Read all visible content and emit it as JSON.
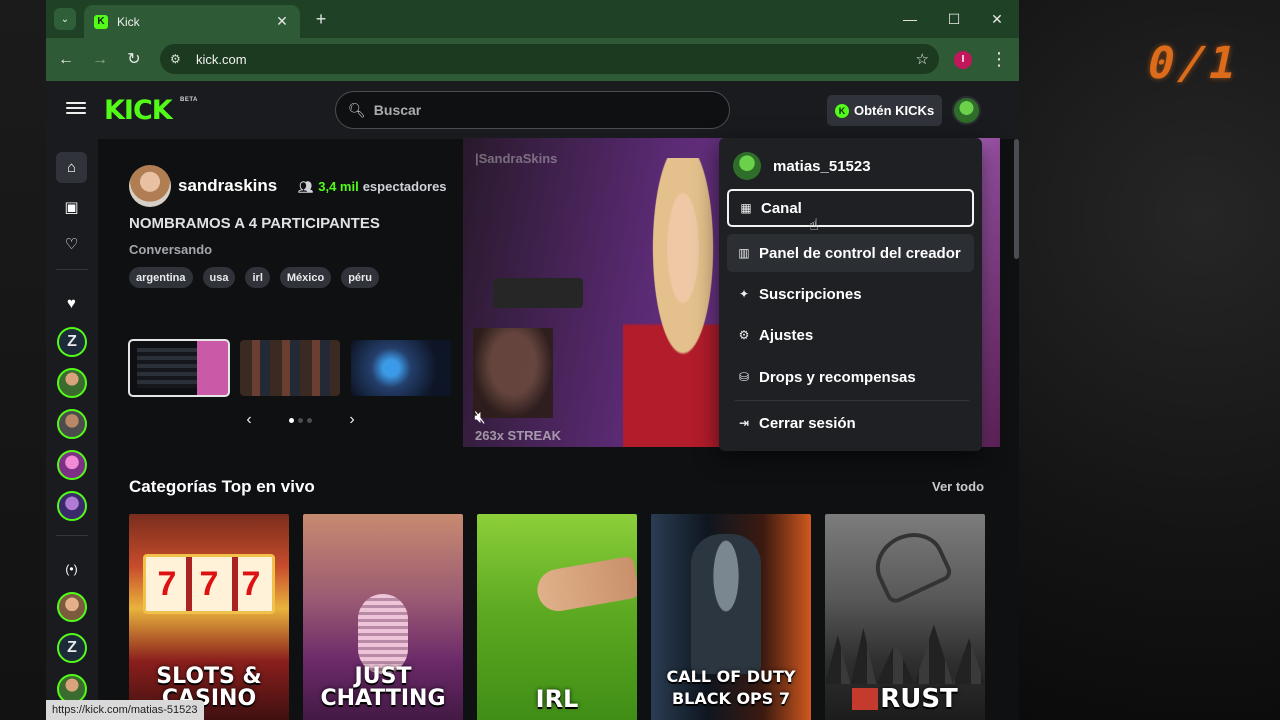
{
  "browser": {
    "tab_title": "Kick",
    "tab_favicon": "K",
    "url": "kick.com",
    "profile_initial": "I",
    "status_url": "https://kick.com/matias-51523"
  },
  "nav": {
    "logo": "KICK",
    "beta": "BETA",
    "search_placeholder": "Buscar",
    "get_kicks": "Obtén KICKs",
    "kicks_coin": "K"
  },
  "featured": {
    "streamer": "sandraskins",
    "viewer_count": "3,4 mil",
    "viewers_label": "espectadores",
    "title": "NOMBRAMOS A 4 PARTICIPANTES",
    "category": "Conversando",
    "tags": [
      "argentina",
      "usa",
      "irl",
      "México",
      "péru"
    ],
    "video_overlay": "|SandraSkins",
    "streak_text": "263x STREAK"
  },
  "dropdown": {
    "username": "matias_51523",
    "items": [
      {
        "label": "Canal",
        "icon": "channel-icon"
      },
      {
        "label": "Panel de control del creador",
        "icon": "dashboard-icon"
      },
      {
        "label": "Suscripciones",
        "icon": "sparkle-icon"
      },
      {
        "label": "Ajustes",
        "icon": "gear-icon"
      },
      {
        "label": "Drops y recompensas",
        "icon": "drops-icon"
      },
      {
        "label": "Cerrar sesión",
        "icon": "logout-icon"
      }
    ]
  },
  "categories": {
    "title": "Categorías Top en vivo",
    "see_all": "Ver todo",
    "items": [
      {
        "label": "SLOTS & CASINO"
      },
      {
        "label": "JUST CHATTING"
      },
      {
        "label": "IRL"
      },
      {
        "label": "CALL OF DUTY BLACK OPS 7"
      },
      {
        "label": "RUST"
      }
    ]
  },
  "sidebar": {
    "z_letter": "Z",
    "live_label": "(•)"
  },
  "desktop": {
    "counter": "0/1"
  },
  "colors": {
    "kick_green": "#53fc18",
    "browser_frame": "#2e5a35",
    "page_bg": "#0f1012"
  }
}
